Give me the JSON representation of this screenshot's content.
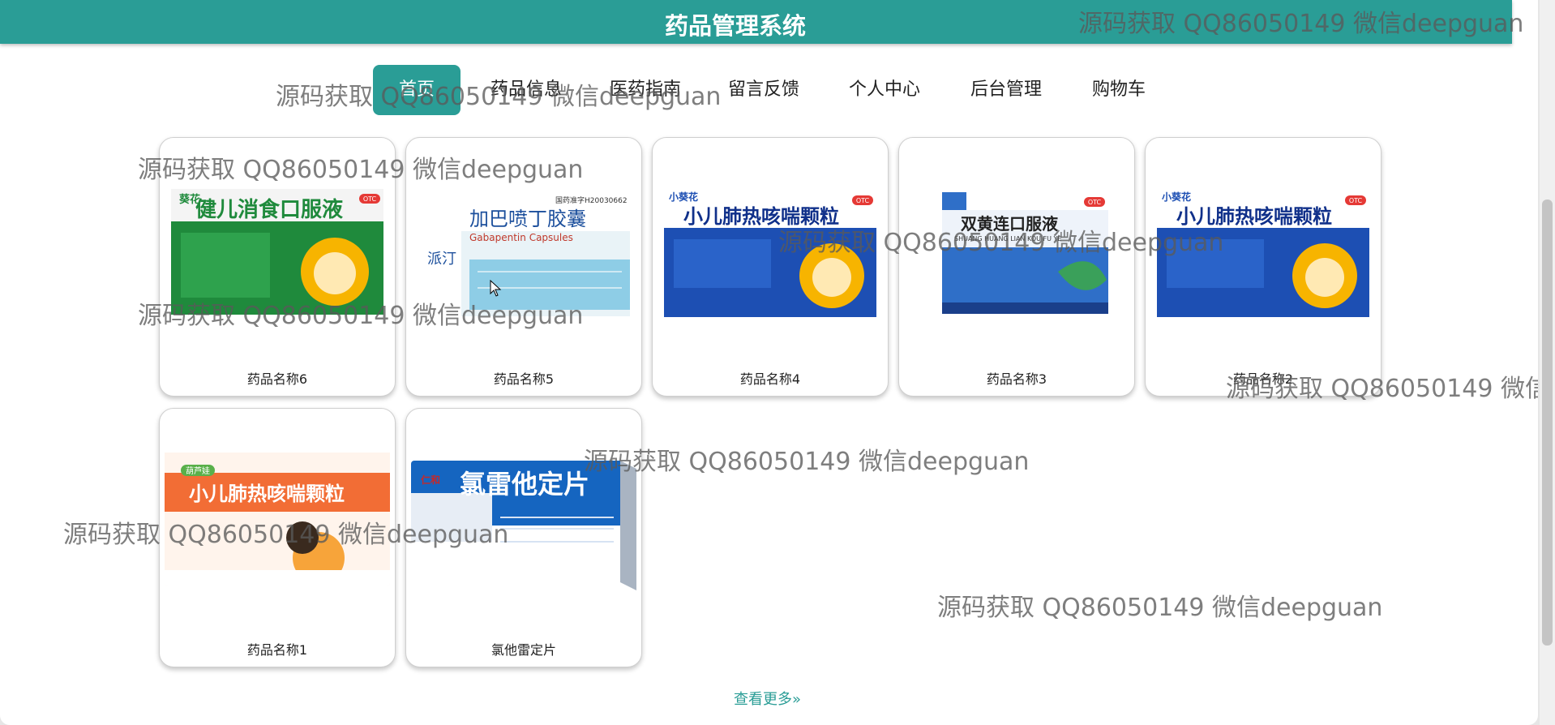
{
  "header": {
    "title": "药品管理系统"
  },
  "nav": {
    "items": [
      {
        "label": "首页",
        "active": true
      },
      {
        "label": "药品信息"
      },
      {
        "label": "医药指南"
      },
      {
        "label": "留言反馈"
      },
      {
        "label": "个人中心"
      },
      {
        "label": "后台管理"
      },
      {
        "label": "购物车"
      }
    ]
  },
  "products": [
    {
      "name": "药品名称6",
      "box_title": "健儿消食口服液",
      "brand": "葵花",
      "badge": "OTC",
      "box_color": "#1f8a3c"
    },
    {
      "name": "药品名称5",
      "box_title": "加巴喷丁胶囊",
      "box_subtitle": "Gabapentin Capsules",
      "brand": "派汀",
      "approval": "国药准字H20030662",
      "box_color": "#8ecde6"
    },
    {
      "name": "药品名称4",
      "box_title": "小儿肺热咳喘颗粒",
      "brand": "小葵花",
      "badge": "OTC",
      "box_color": "#1d4fb3"
    },
    {
      "name": "药品名称3",
      "box_title": "双黄连口服液",
      "box_subtitle": "SHUANG HUANG LIAN KOU FU YE",
      "badge": "OTC",
      "box_color": "#2f6fc8"
    },
    {
      "name": "药品名称2",
      "box_title": "小儿肺热咳喘颗粒",
      "brand": "小葵花",
      "badge": "OTC",
      "box_color": "#1d4fb3"
    },
    {
      "name": "药品名称1",
      "box_title": "小儿肺热咳喘颗粒",
      "brand": "葫芦娃",
      "box_color": "#f26d35"
    },
    {
      "name": "氯他雷定片",
      "box_title": "氯雷他定片",
      "brand": "仁和",
      "box_color": "#1565c0"
    }
  ],
  "more": {
    "label": "查看更多"
  },
  "watermark": "源码获取 QQ86050149 微信deepguan",
  "colors": {
    "primary": "#2a9d96",
    "card_border": "#cfcfcf"
  }
}
